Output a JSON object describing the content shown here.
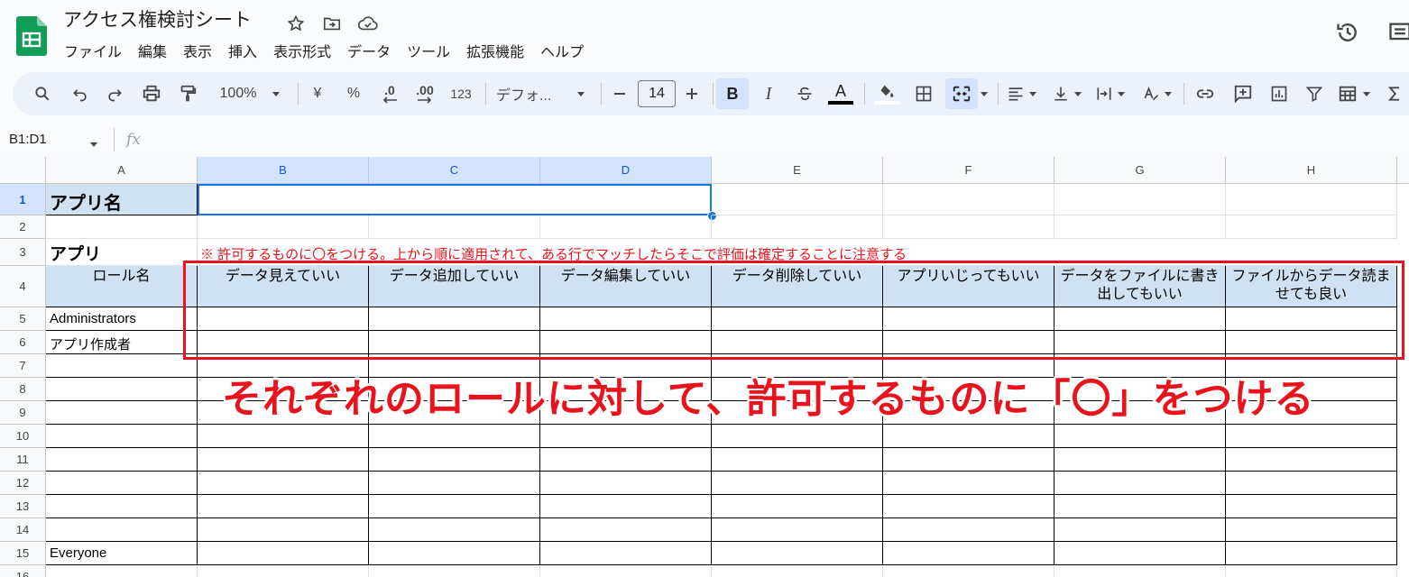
{
  "app": {
    "doc_title": "アクセス権検討シート",
    "menu": [
      "ファイル",
      "編集",
      "表示",
      "挿入",
      "表示形式",
      "データ",
      "ツール",
      "拡張機能",
      "ヘルプ"
    ]
  },
  "toolbar": {
    "zoom": "100%",
    "currency": "¥",
    "percent": "%",
    "decrease_decimal": ".0",
    "increase_decimal": ".00",
    "number_format": "123",
    "font_name": "デフォ...",
    "font_size": "14",
    "bold": "B",
    "italic": "I",
    "text_color_label": "A"
  },
  "formula_bar": {
    "name_box": "B1:D1",
    "fx": "fx",
    "value": ""
  },
  "grid": {
    "columns": [
      "A",
      "B",
      "C",
      "D",
      "E",
      "F",
      "G",
      "H"
    ],
    "selected_columns": [
      "B",
      "C",
      "D"
    ],
    "rows": [
      "1",
      "2",
      "3",
      "4",
      "5",
      "6",
      "7",
      "8",
      "9",
      "10",
      "11",
      "12",
      "13",
      "14",
      "15",
      "16"
    ],
    "selected_row": "1",
    "cells": {
      "A1": "アプリ名",
      "A3": "アプリ",
      "B3_note": "※ 許可するものに〇をつける。上から順に適用されて、ある行でマッチしたらそこで評価は確定することに注意する",
      "A4": "ロール名",
      "B4": "データ見えていい",
      "C4": "データ追加していい",
      "D4": "データ編集していい",
      "E4": "データ削除していい",
      "F4": "アプリいじってもいい",
      "G4": "データをファイルに書き出してもいい",
      "H4": "ファイルからデータ読ませても良い",
      "A5": "Administrators",
      "A6": "アプリ作成者",
      "A15": "Everyone"
    }
  },
  "annotation": {
    "text": "それぞれのロールに対して、許可するものに「〇」をつける",
    "color": "#e8131d"
  },
  "colors": {
    "accent": "#0b57d0",
    "header_fill": "#cfe2f3",
    "selection": "#d3e3fd",
    "sheets_green": "#0f9d58"
  }
}
